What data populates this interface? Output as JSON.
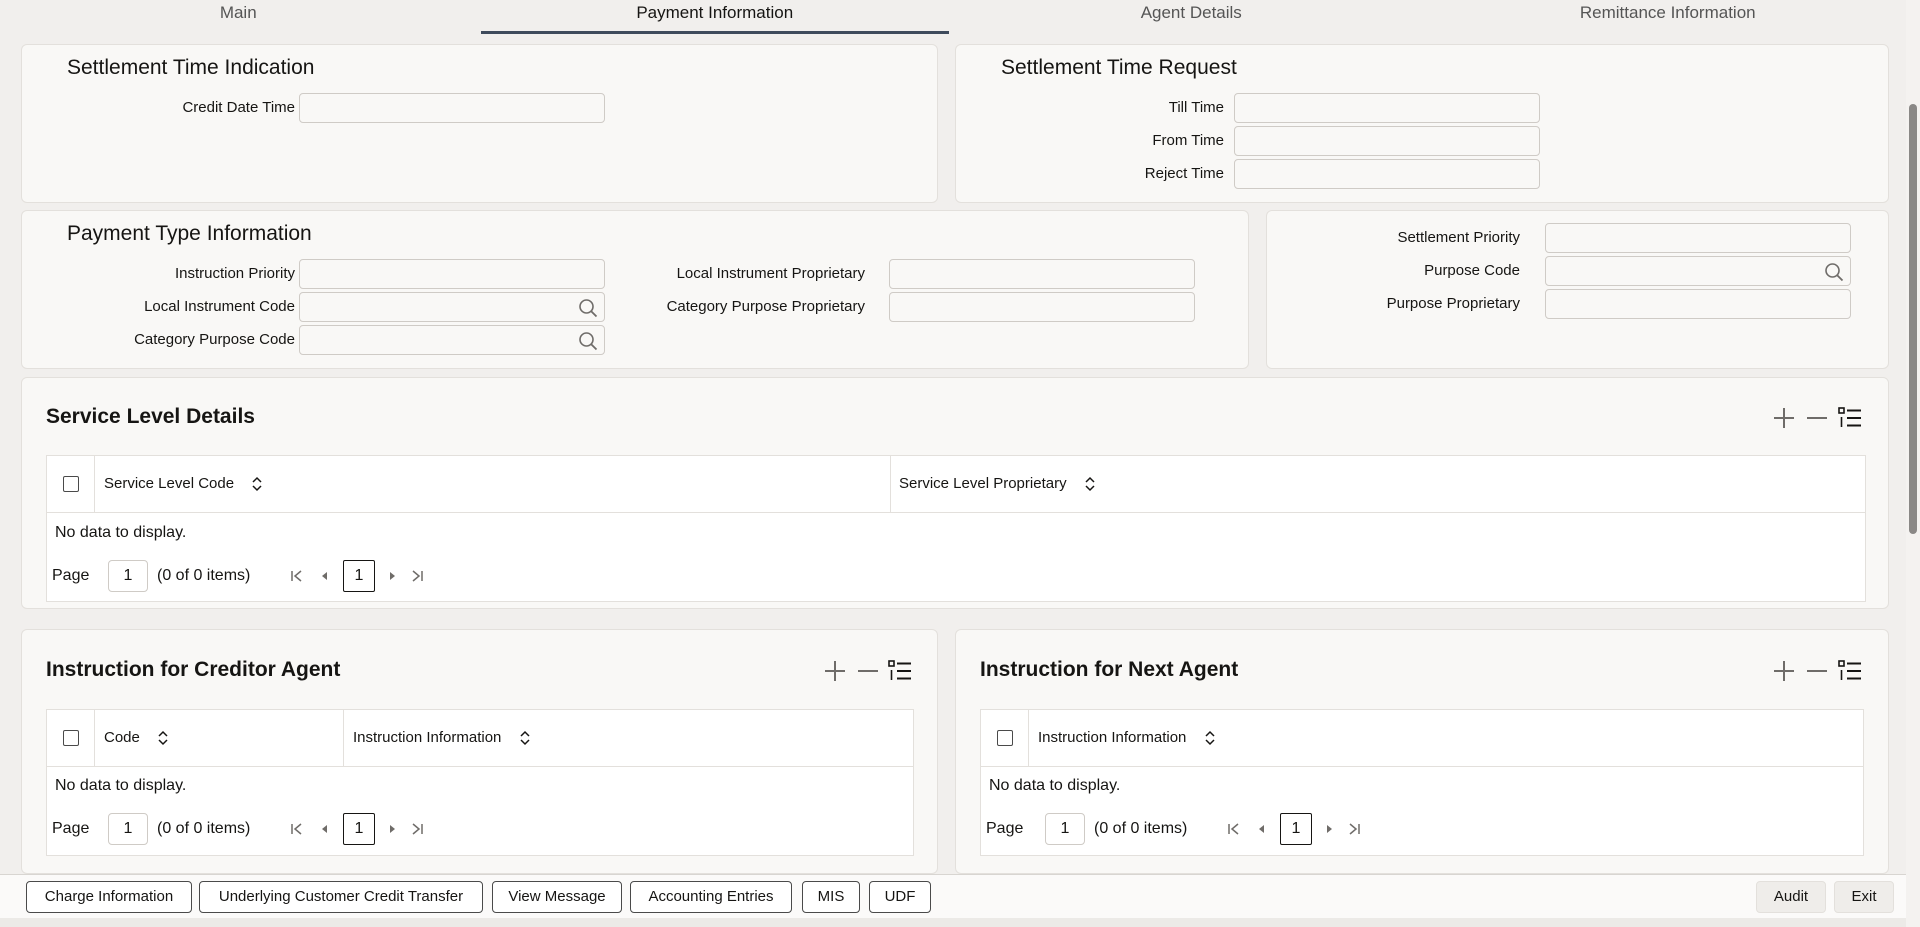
{
  "tabs": [
    "Main",
    "Payment Information",
    "Agent Details",
    "Remittance Information"
  ],
  "settlement_time_indication": {
    "title": "Settlement Time Indication",
    "credit_date_time_label": "Credit Date Time",
    "credit_date_time_value": ""
  },
  "settlement_time_request": {
    "title": "Settlement Time Request",
    "till_time_label": "Till Time",
    "from_time_label": "From Time",
    "reject_time_label": "Reject Time"
  },
  "payment_type_information": {
    "title": "Payment Type Information",
    "instruction_priority_label": "Instruction Priority",
    "local_instrument_code_label": "Local Instrument Code",
    "category_purpose_code_label": "Category Purpose Code",
    "local_instrument_proprietary_label": "Local Instrument Proprietary",
    "category_purpose_proprietary_label": "Category Purpose Proprietary"
  },
  "settlement_priority_panel": {
    "settlement_priority_label": "Settlement Priority",
    "purpose_code_label": "Purpose Code",
    "purpose_proprietary_label": "Purpose Proprietary"
  },
  "service_level_details": {
    "title": "Service Level Details",
    "columns": [
      "Service Level Code",
      "Service Level Proprietary"
    ],
    "no_data": "No data to display.",
    "page_label": "Page",
    "page_value": "1",
    "items_text": "(0 of 0 items)",
    "current_page": "1"
  },
  "instruction_creditor_agent": {
    "title": "Instruction for Creditor Agent",
    "columns": [
      "Code",
      "Instruction Information"
    ],
    "no_data": "No data to display.",
    "page_label": "Page",
    "page_value": "1",
    "items_text": "(0 of 0 items)",
    "current_page": "1"
  },
  "instruction_next_agent": {
    "title": "Instruction for Next Agent",
    "columns": [
      "Instruction Information"
    ],
    "no_data": "No data to display.",
    "page_label": "Page",
    "page_value": "1",
    "items_text": "(0 of 0 items)",
    "current_page": "1"
  },
  "footer": {
    "buttons": [
      "Charge Information",
      "Underlying Customer Credit Transfer",
      "View Message",
      "Accounting Entries",
      "MIS",
      "UDF"
    ],
    "audit": "Audit",
    "exit": "Exit"
  },
  "icons": {
    "search": "search-icon",
    "add": "plus-icon",
    "remove": "minus-icon",
    "columns": "list-icon",
    "sort": "sort-icon"
  },
  "colors": {
    "accent": "#3f4b5c",
    "background": "#f1efed",
    "panel": "#f9f8f6"
  }
}
